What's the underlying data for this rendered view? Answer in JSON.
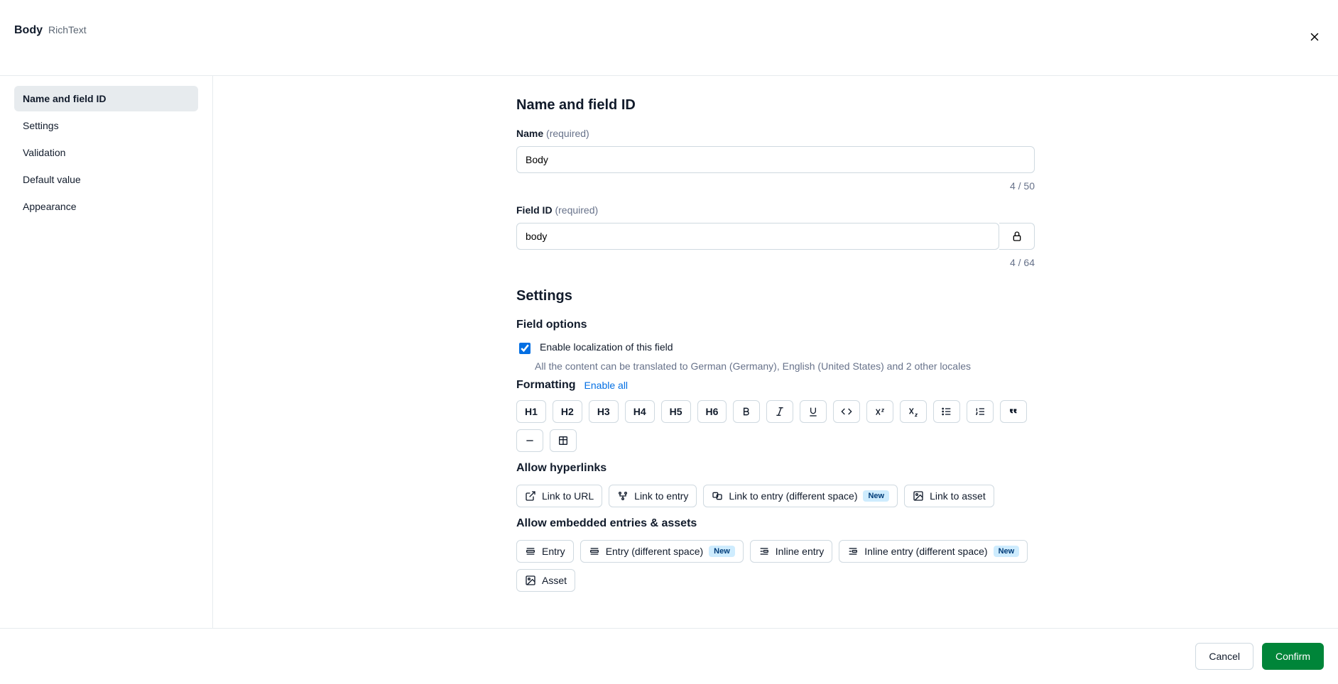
{
  "header": {
    "title": "Body",
    "subtitle": "RichText"
  },
  "sidebar": {
    "items": [
      {
        "label": "Name and field ID",
        "active": true
      },
      {
        "label": "Settings",
        "active": false
      },
      {
        "label": "Validation",
        "active": false
      },
      {
        "label": "Default value",
        "active": false
      },
      {
        "label": "Appearance",
        "active": false
      }
    ]
  },
  "sections": {
    "name_id": {
      "heading": "Name and field ID",
      "name_label": "Name",
      "name_req": "(required)",
      "name_value": "Body",
      "name_counter": "4 / 50",
      "fieldid_label": "Field ID",
      "fieldid_req": "(required)",
      "fieldid_value": "body",
      "fieldid_counter": "4 / 64"
    },
    "settings": {
      "heading": "Settings",
      "field_options_heading": "Field options",
      "loc_label": "Enable localization of this field",
      "loc_desc": "All the content can be translated to German (Germany), English (United States) and 2 other locales",
      "formatting_title": "Formatting",
      "enable_all": "Enable all",
      "headings": {
        "h1": "H1",
        "h2": "H2",
        "h3": "H3",
        "h4": "H4",
        "h5": "H5",
        "h6": "H6"
      },
      "hyperlinks_heading": "Allow hyperlinks",
      "link_url": "Link to URL",
      "link_entry": "Link to entry",
      "link_entry_ds": "Link to entry (different space)",
      "link_asset": "Link to asset",
      "new_badge": "New",
      "embed_heading": "Allow embedded entries & assets",
      "embed_entry": "Entry",
      "embed_entry_ds": "Entry (different space)",
      "embed_inline": "Inline entry",
      "embed_inline_ds": "Inline entry (different space)",
      "embed_asset": "Asset"
    }
  },
  "footer": {
    "cancel": "Cancel",
    "confirm": "Confirm"
  }
}
